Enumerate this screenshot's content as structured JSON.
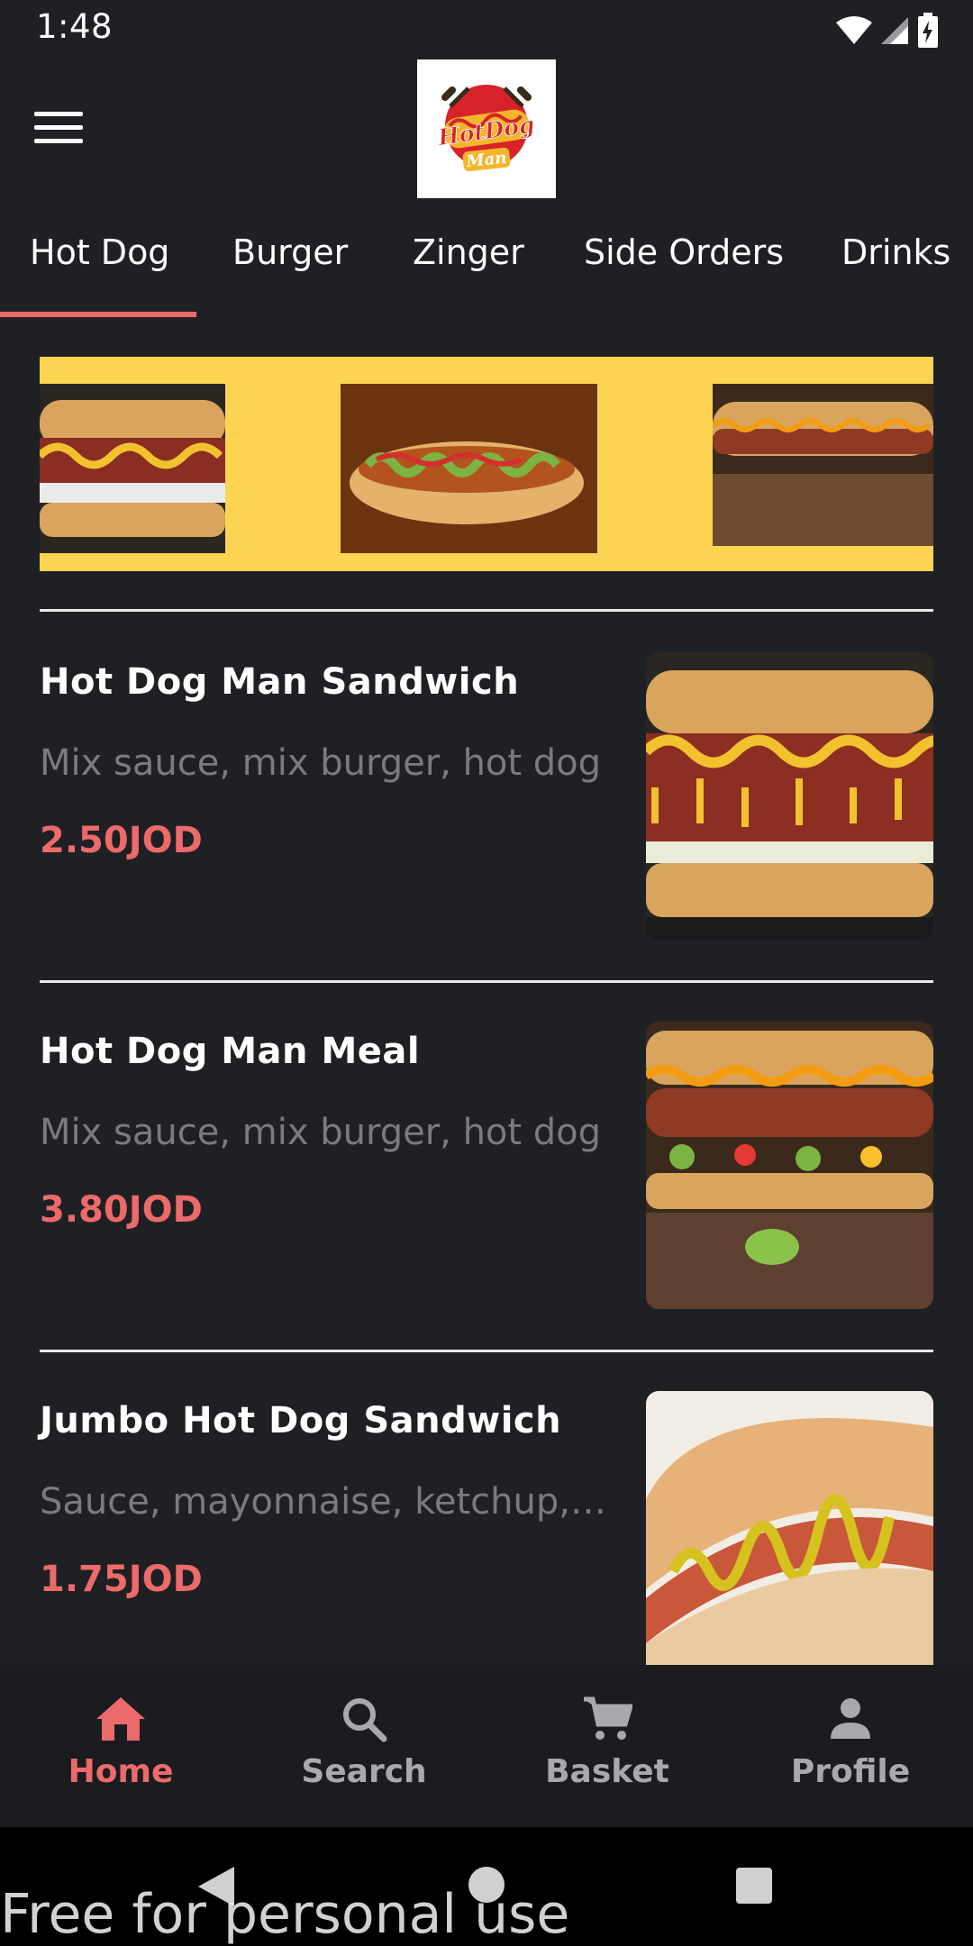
{
  "status": {
    "time": "1:48"
  },
  "header": {
    "logo_text": "HotDog Man",
    "menu_icon": "menu-icon"
  },
  "tabs": [
    {
      "label": "Hot Dog",
      "selected": true
    },
    {
      "label": "Burger"
    },
    {
      "label": "Zinger"
    },
    {
      "label": "Side Orders"
    },
    {
      "label": "Drinks"
    }
  ],
  "products": [
    {
      "name": "Hot Dog Man Sandwich",
      "description": "Mix sauce, mix burger, hot dog",
      "price": "2.50JOD"
    },
    {
      "name": "Hot Dog Man Meal",
      "description": "Mix sauce, mix burger, hot dog",
      "price": "3.80JOD"
    },
    {
      "name": "Jumbo Hot Dog Sandwich",
      "description": "Sauce, mayonnaise, ketchup, …",
      "price": "1.75JOD"
    }
  ],
  "bottom_nav": [
    {
      "label": "Home",
      "icon": "home-icon",
      "active": true
    },
    {
      "label": "Search",
      "icon": "search-icon"
    },
    {
      "label": "Basket",
      "icon": "cart-icon"
    },
    {
      "label": "Profile",
      "icon": "person-icon"
    }
  ],
  "watermark": "Free for personal use",
  "colors": {
    "background": "#1f2024",
    "accent": "#ec6a6a",
    "banner": "#fdd451",
    "muted_text": "#7a7b80"
  }
}
